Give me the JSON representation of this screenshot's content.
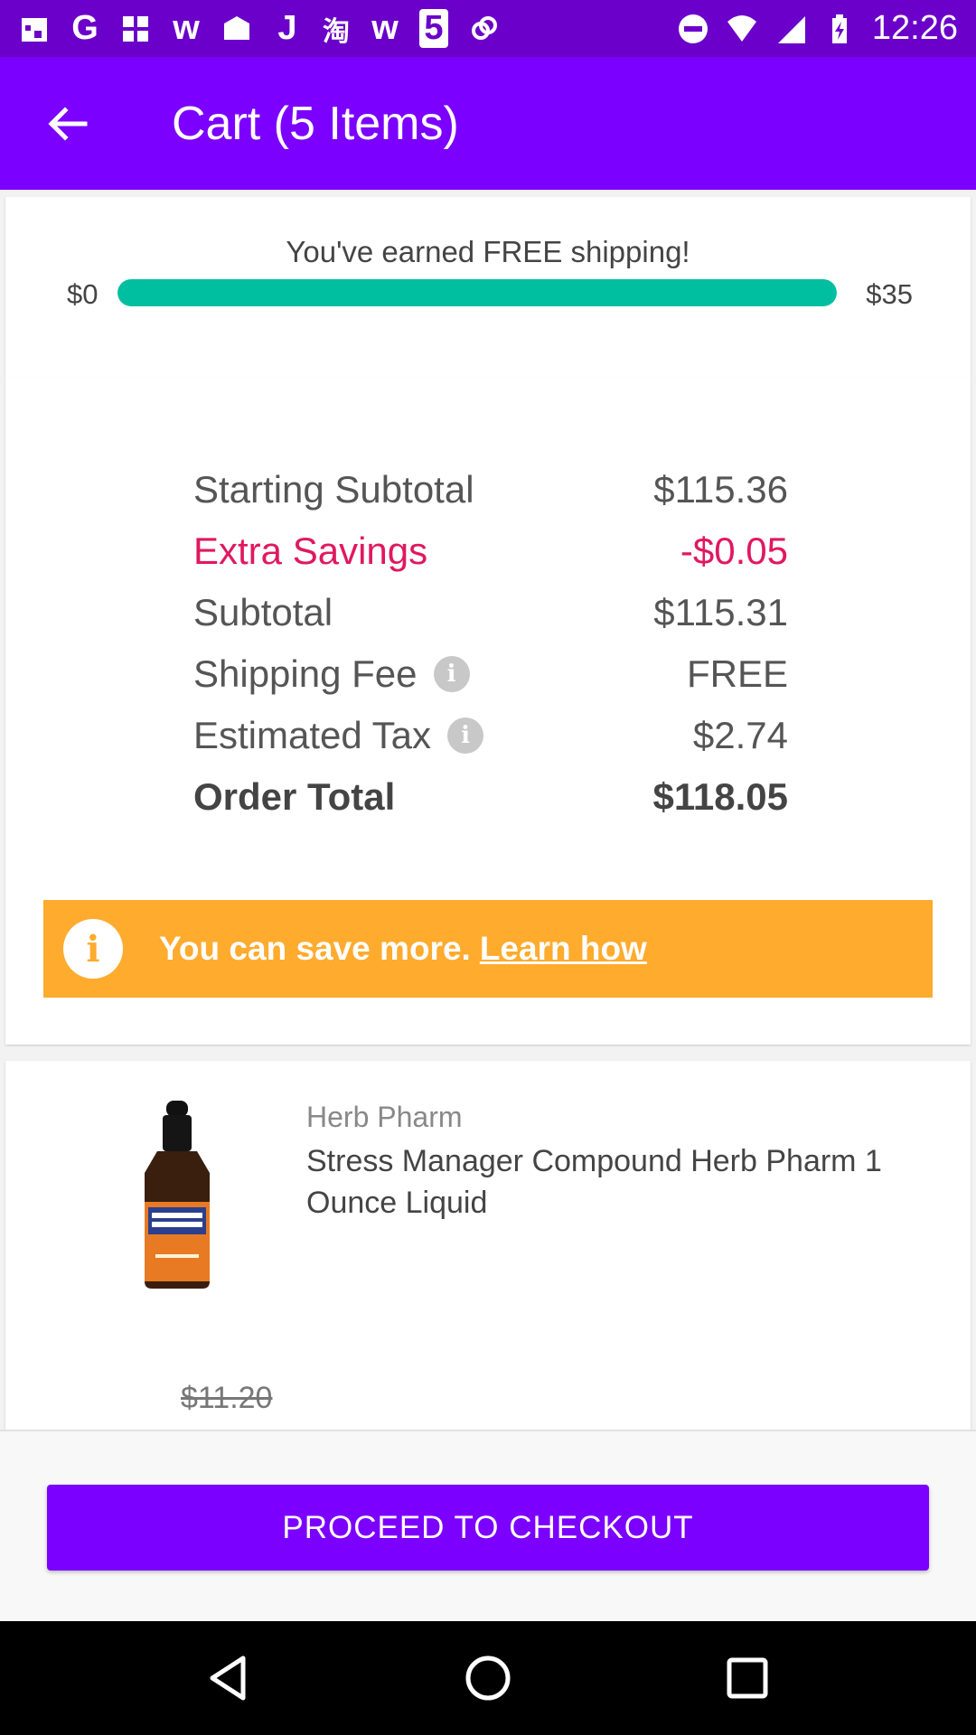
{
  "status_bar": {
    "time": "12:26",
    "left_icons": [
      "calendar-icon",
      "G",
      "grid-icon",
      "w",
      "mail-icon",
      "J",
      "淘",
      "w",
      "5",
      "link-icon"
    ],
    "right_icons": [
      "dnd-icon",
      "wifi-icon",
      "signal-icon",
      "battery-icon"
    ]
  },
  "app_bar": {
    "title": "Cart (5 Items)",
    "back_icon": "arrow-left-icon"
  },
  "shipping": {
    "message": "You've earned FREE shipping!",
    "min_label": "$0",
    "max_label": "$35",
    "progress_fraction": 1.0,
    "progress_color": "#00bfa0"
  },
  "summary": {
    "rows": [
      {
        "label": "Starting Subtotal",
        "value": "$115.36"
      },
      {
        "label": "Extra Savings",
        "value": "-$0.05"
      },
      {
        "label": "Subtotal",
        "value": "$115.31"
      },
      {
        "label": "Shipping Fee",
        "value": "FREE"
      },
      {
        "label": "Estimated Tax",
        "value": "$2.74"
      },
      {
        "label": "Order Total",
        "value": "$118.05"
      }
    ],
    "savings_color": "#e0185f"
  },
  "banner": {
    "text": "You can save more.",
    "link": "Learn how",
    "color": "#ffab2e"
  },
  "product": {
    "brand": "Herb Pharm",
    "name": "Stress Manager Compound Herb Pharm 1 Ounce Liquid",
    "old_price": "$11.20"
  },
  "checkout": {
    "button_label": "PROCEED TO CHECKOUT",
    "color": "#7b00ff"
  },
  "nav_bar": {
    "icons": [
      "back-triangle-icon",
      "home-circle-icon",
      "recents-square-icon"
    ]
  }
}
